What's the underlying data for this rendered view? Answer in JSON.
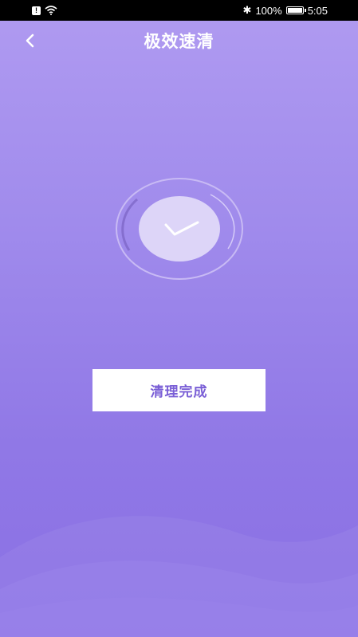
{
  "status_bar": {
    "sim_glyph": "!",
    "wifi_icon": "wifi-icon",
    "bluetooth_glyph": "✱",
    "battery_text": "100%",
    "time": "5:05"
  },
  "header": {
    "back_icon": "chevron-left-icon",
    "title": "极效速清"
  },
  "main": {
    "status_icon": "check-icon",
    "done_button_label": "清理完成"
  },
  "colors": {
    "background_top": "#b09bf1",
    "background_bottom": "#8a70e4",
    "button_text": "#7a5fd6"
  }
}
